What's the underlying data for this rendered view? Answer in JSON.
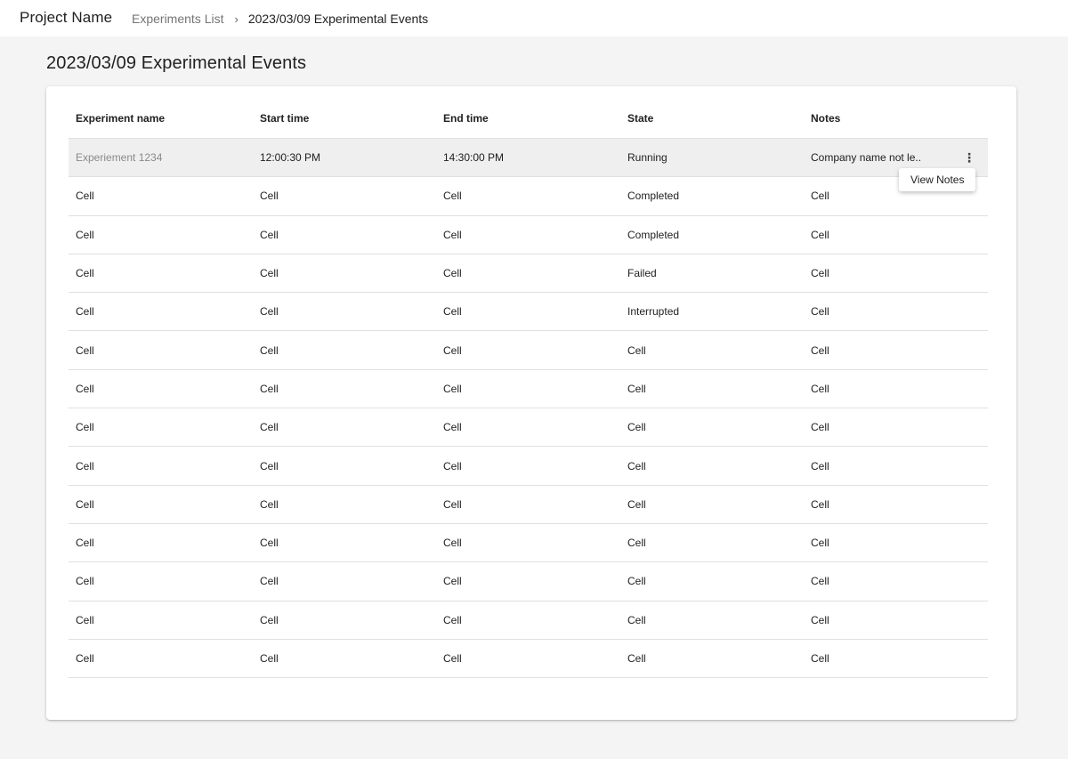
{
  "header": {
    "project_name": "Project Name",
    "breadcrumb": {
      "link": "Experiments List",
      "separator": "›",
      "current": "2023/03/09 Experimental Events"
    }
  },
  "page": {
    "title": "2023/03/09 Experimental Events"
  },
  "table": {
    "columns": [
      "Experiment name",
      "Start time",
      "End time",
      "State",
      "Notes"
    ],
    "rows": [
      [
        "Experiement 1234",
        "12:00:30 PM",
        "14:30:00 PM",
        "Running",
        "Company name not le.."
      ],
      [
        "Cell",
        "Cell",
        "Cell",
        "Completed",
        "Cell"
      ],
      [
        "Cell",
        "Cell",
        "Cell",
        "Completed",
        "Cell"
      ],
      [
        "Cell",
        "Cell",
        "Cell",
        "Failed",
        "Cell"
      ],
      [
        "Cell",
        "Cell",
        "Cell",
        "Interrupted",
        "Cell"
      ],
      [
        "Cell",
        "Cell",
        "Cell",
        "Cell",
        "Cell"
      ],
      [
        "Cell",
        "Cell",
        "Cell",
        "Cell",
        "Cell"
      ],
      [
        "Cell",
        "Cell",
        "Cell",
        "Cell",
        "Cell"
      ],
      [
        "Cell",
        "Cell",
        "Cell",
        "Cell",
        "Cell"
      ],
      [
        "Cell",
        "Cell",
        "Cell",
        "Cell",
        "Cell"
      ],
      [
        "Cell",
        "Cell",
        "Cell",
        "Cell",
        "Cell"
      ],
      [
        "Cell",
        "Cell",
        "Cell",
        "Cell",
        "Cell"
      ],
      [
        "Cell",
        "Cell",
        "Cell",
        "Cell",
        "Cell"
      ],
      [
        "Cell",
        "Cell",
        "Cell",
        "Cell",
        "Cell"
      ]
    ],
    "row_menu_icon": "more-vert-icon",
    "kebab_glyph": "⋮"
  },
  "context_menu": {
    "items": [
      "View Notes"
    ]
  }
}
